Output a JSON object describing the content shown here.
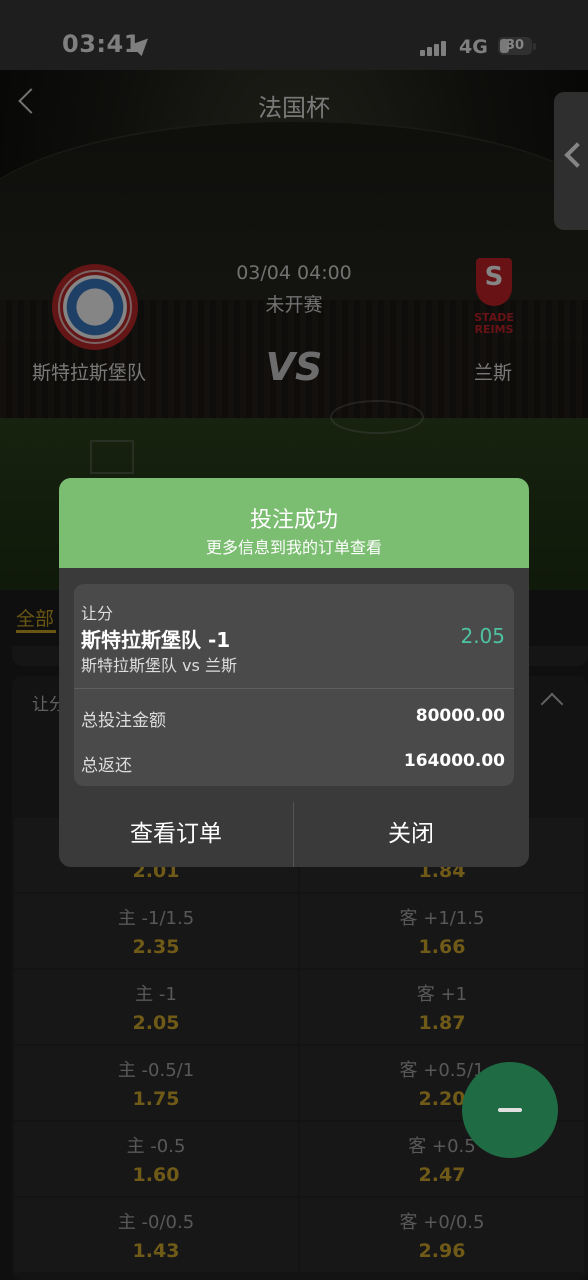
{
  "status_bar": {
    "time": "03:41",
    "network": "4G",
    "battery": "30"
  },
  "header": {
    "title": "法国杯"
  },
  "match": {
    "datetime": "03/04 04:00",
    "status": "未开赛",
    "vs_label": "VS",
    "home_team": "斯特拉斯堡队",
    "away_team": "兰斯",
    "away_logo_text": "STADE REIMS",
    "away_logo_letter": "S"
  },
  "tabs": {
    "all": "全部"
  },
  "market": {
    "label": "让分"
  },
  "odds": [
    {
      "home_line": "主 -1/1.5",
      "home_price": "2.35",
      "away_line": "客 +1/1.5",
      "away_price": "1.66"
    },
    {
      "home_line": "主 -1",
      "home_price": "2.05",
      "away_line": "客 +1",
      "away_price": "1.87"
    },
    {
      "home_line": "主 -0.5/1",
      "home_price": "1.75",
      "away_line": "客 +0.5/1",
      "away_price": "2.20"
    },
    {
      "home_line": "主 -0.5",
      "home_price": "1.60",
      "away_line": "客 +0.5",
      "away_price": "2.47"
    },
    {
      "home_line": "主 -0/0.5",
      "home_price": "1.43",
      "away_line": "客 +0/0.5",
      "away_price": "2.96"
    }
  ],
  "partial_odds": {
    "home_price": "2.01",
    "away_price": "1.84"
  },
  "modal": {
    "title": "投注成功",
    "subtitle": "更多信息到我的订单查看",
    "bet_market": "让分",
    "bet_selection": "斯特拉斯堡队 -1",
    "bet_odds": "2.05",
    "bet_match": "斯特拉斯堡队 vs 兰斯",
    "total_stake_label": "总投注金额",
    "total_stake_value": "80000.00",
    "total_return_label": "总返还",
    "total_return_value": "164000.00",
    "view_order_label": "查看订单",
    "close_label": "关闭"
  },
  "colors": {
    "header_green": "#7bbd71",
    "odds_gold": "#d6ad2f",
    "odds_teal": "#4fc3a1"
  },
  "icons": {
    "back": "chevron-left-icon",
    "side": "chevron-left-icon",
    "collapse": "chevron-up-icon",
    "fab": "minus-icon"
  }
}
